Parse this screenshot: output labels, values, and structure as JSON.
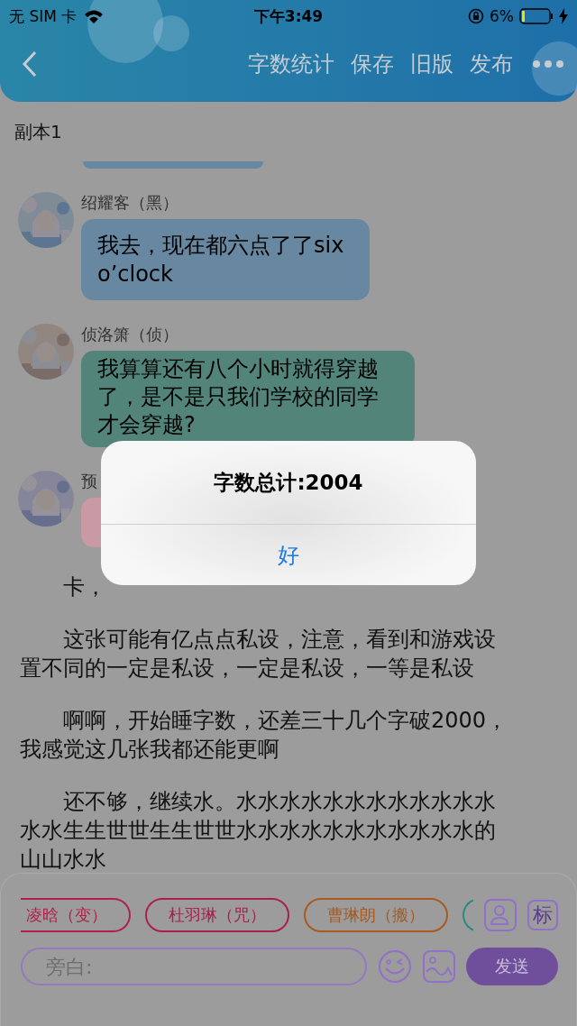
{
  "status_bar": {
    "carrier": "无 SIM 卡",
    "time": "下午3:49",
    "battery": "6%"
  },
  "header": {
    "actions": [
      "字数统计",
      "保存",
      "旧版",
      "发布"
    ]
  },
  "title": "副本1",
  "messages": [
    {
      "sender": "绍耀客（黑）",
      "text": "我去，现在都六点了了six o’clock",
      "color": "#6788a0"
    },
    {
      "sender": "侦洛箫（侦）",
      "text": "我算算还有八个小时就得穿越了，是不是只我们学校的同学才会穿越?",
      "color": "#52847a"
    },
    {
      "sender": "预",
      "color": "#c99aa4"
    }
  ],
  "paragraphs": [
    "卡，",
    "这张可能有亿点点私设，注意，看到和游戏设置不同的一定是私设，一定是私设，一等是私设",
    "啊啊，开始睡字数，还差三十几个字破2000，我感觉这几张我都还能更啊",
    "还不够，继续水。水水水水水水水水水水水水水水生生世世生生世世水水水水水水水水水水水的山山水水"
  ],
  "composer": {
    "chips": [
      {
        "label": "凌晗（变）",
        "color": "#b0204a"
      },
      {
        "label": "杜羽琳（咒）",
        "color": "#a8204c"
      },
      {
        "label": "曹琳朗（搬）",
        "color": "#a85a20"
      },
      {
        "color": "#2a8a80"
      }
    ],
    "tag_button": "标",
    "placeholder": "旁白:",
    "send": "发送"
  },
  "alert": {
    "message": "字数总计:2004",
    "button": "好"
  }
}
